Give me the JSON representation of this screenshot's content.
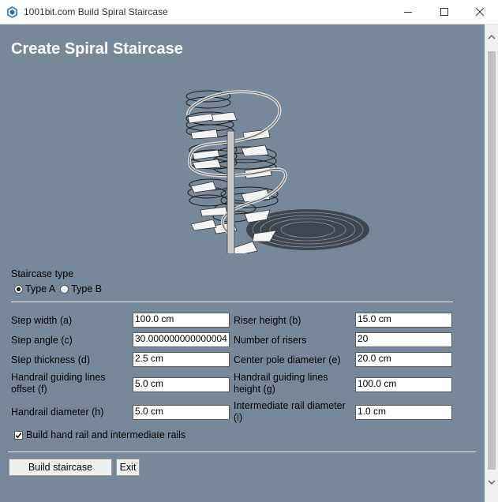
{
  "window": {
    "title": "1001bit.com Build Spiral Staircase"
  },
  "heading": "Create Spiral Staircase",
  "staircase_type": {
    "label": "Staircase type",
    "options": [
      "Type A",
      "Type B"
    ],
    "selected": "Type A"
  },
  "fields": {
    "step_width": {
      "label": "Step width (a)",
      "value": "100.0 cm"
    },
    "riser_height": {
      "label": "Riser height (b)",
      "value": "15.0 cm"
    },
    "step_angle": {
      "label": "Step angle (c)",
      "value": "30.000000000000004"
    },
    "number_of_risers": {
      "label": "Number of risers",
      "value": "20"
    },
    "step_thickness": {
      "label": "Step thickness (d)",
      "value": "2.5 cm"
    },
    "center_pole_diameter": {
      "label": "Center pole diameter (e)",
      "value": "20.0 cm"
    },
    "handrail_offset": {
      "label_line1": "Handrail guiding lines",
      "label_line2": "offset (f)",
      "value": "5.0 cm"
    },
    "handrail_height": {
      "label_line1": "Handrail guiding lines",
      "label_line2": "height (g)",
      "value": "100.0 cm"
    },
    "handrail_diameter": {
      "label": "Handrail diameter (h)",
      "value": "5.0 cm"
    },
    "intermediate_rail_diameter": {
      "label_line1": "Intermediate rail diameter",
      "label_line2": "(i)",
      "value": "1.0 cm"
    }
  },
  "build_rails": {
    "label": "Build hand rail and intermediate rails",
    "checked": true
  },
  "buttons": {
    "build": "Build staircase",
    "exit": "Exit"
  },
  "colors": {
    "panel_bg": "#778899",
    "heading": "#ffffff",
    "app_icon": "#1f6fa8"
  }
}
